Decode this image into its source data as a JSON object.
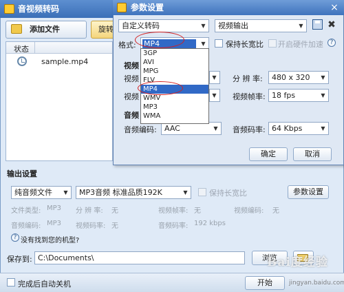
{
  "main": {
    "title": "音视频转码",
    "add_file": "添加文件",
    "rotate": "旋转",
    "list": {
      "status_header": "状态",
      "file_name": "sample.mp4"
    },
    "output": {
      "label": "输出设置",
      "type": "纯音频文件",
      "preset": "MP3音频 标准品质192K",
      "keep_ratio": "保持长宽比",
      "param_button": "参数设置",
      "ghost": {
        "file_fmt_lbl": "文件类型:",
        "file_fmt": "MP3",
        "res_lbl": "分 辨 率:",
        "res": "无",
        "fps_lbl": "视频帧率:",
        "fps": "无",
        "vcodec_lbl": "视频编码:",
        "vcodec": "无",
        "acodec_lbl": "音频编码:",
        "acodec": "MP3",
        "vbitrate_lbl": "视频码率:",
        "vbitrate": "无",
        "abitrate_lbl": "音频码率:",
        "abitrate": "192 kbps"
      },
      "no_device": "没有找到您的机型?"
    },
    "save_to": {
      "label": "保存到:",
      "path": "C:\\Documents\\",
      "browse": "浏览"
    },
    "bottom": {
      "shutdown": "完成后自动关机",
      "start": "开始"
    },
    "watermark": "Bai度经验",
    "watermark_sub": "jingyan.baidu.com"
  },
  "dialog": {
    "title": "参数设置",
    "close": "×",
    "preset": "自定义转码",
    "output_kind": "视频输出",
    "format_label": "格式:",
    "format_value": "MP4",
    "keep_ratio": "保持长宽比",
    "hw_accel": "开启硬件加速",
    "video": {
      "label": "视频",
      "codec_lbl": "视频",
      "bitrate_lbl": "视频",
      "res_lbl": "分 辨 率:",
      "res": "480 x 320",
      "fps_lbl": "视频帧率:",
      "fps": "18 fps"
    },
    "audio": {
      "label": "音频",
      "codec_lbl": "音频编码:",
      "codec": "AAC",
      "rate_lbl": "音频码率:",
      "rate": "64 Kbps"
    },
    "ok": "确定",
    "cancel": "取消",
    "dropdown": [
      "3GP",
      "AVI",
      "MPG",
      "FLV",
      "MP4",
      "WMV",
      "MP3",
      "WMA"
    ],
    "dropdown_selected": "MP4"
  },
  "colors": {
    "title_bar": "#3b6fb8",
    "selection": "#3169c6",
    "highlight_ring": "#d41f1f"
  }
}
